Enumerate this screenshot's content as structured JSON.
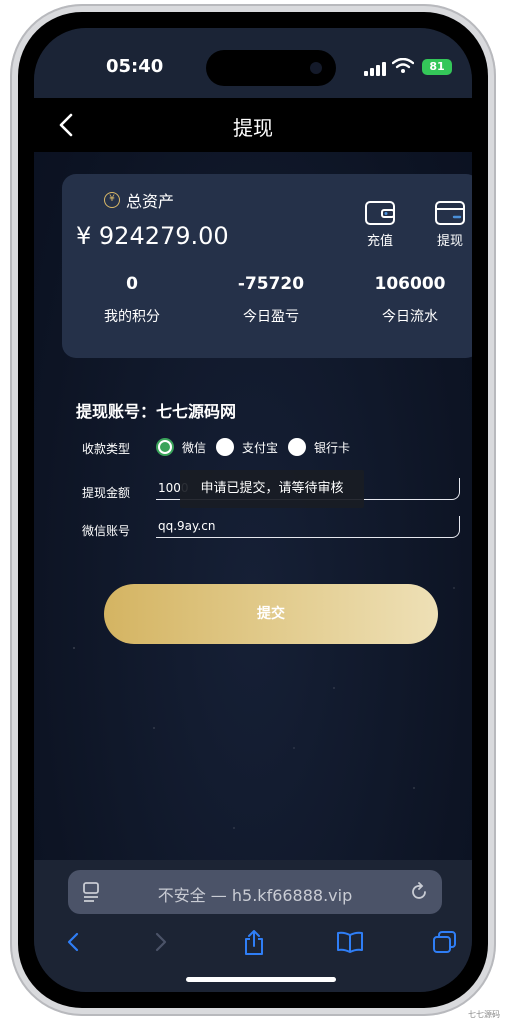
{
  "status": {
    "time": "05:40",
    "battery": "81"
  },
  "nav": {
    "title": "提现"
  },
  "assets": {
    "label": "总资产",
    "amount": "¥ 924279.00",
    "recharge_label": "充值",
    "withdraw_label": "提现",
    "stats": [
      {
        "value": "0",
        "label": "我的积分"
      },
      {
        "value": "-75720",
        "label": "今日盈亏"
      },
      {
        "value": "106000",
        "label": "今日流水"
      }
    ]
  },
  "form": {
    "account_label": "提现账号：七七源码网",
    "payment_type_label": "收款类型",
    "payment_options": [
      "微信",
      "支付宝",
      "银行卡"
    ],
    "selected_option": "微信",
    "amount_label": "提现金额",
    "amount_value": "1000",
    "wechat_label": "微信账号",
    "wechat_value": "qq.9ay.cn",
    "submit_label": "提交"
  },
  "toast": {
    "message": "申请已提交，请等待审核"
  },
  "browser": {
    "url": "不安全 — h5.kf66888.vip"
  },
  "watermark": "七七源码",
  "colors": {
    "accent_gold": "#d4b462",
    "card_bg": "#253149",
    "radio_checked": "#3aa35a"
  }
}
